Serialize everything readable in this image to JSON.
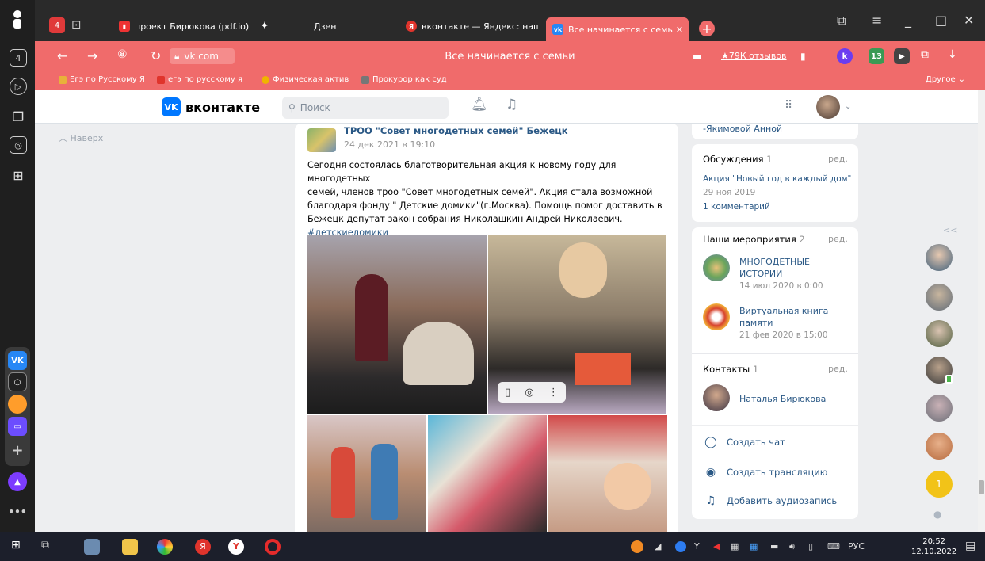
{
  "browser": {
    "tabs": [
      {
        "label": "проект Бирюкова (pdf.io)",
        "favicon": "pdf-icon"
      },
      {
        "label": "Дзен",
        "favicon": "zen-icon"
      },
      {
        "label": "вконтакте — Яндекс: наш",
        "favicon": "yandex-icon"
      },
      {
        "label": "Все начинается с семь",
        "favicon": "vk-icon",
        "active": true
      }
    ],
    "tab_count_badge": "4",
    "url": "vk.com",
    "page_title": "Все начинается с семьи",
    "reviews": "★79К отзывов",
    "ext_badge": "13",
    "other_bookmarks": "Другое",
    "bookmarks": [
      {
        "label": "Егэ по Русскому Я",
        "color": "#e8b13a"
      },
      {
        "label": "егэ по русскому я",
        "color": "#e0342c"
      },
      {
        "label": "Физическая актив",
        "color": "#f0b400"
      },
      {
        "label": "Прокурор как суд",
        "color": "#777777"
      }
    ],
    "accent_color": "#f06b6b"
  },
  "vk": {
    "logo_text": "вконтакте",
    "logo_badge": "VK",
    "search_placeholder": "Поиск",
    "back_to_top": "Наверх",
    "post": {
      "group_name": "ТРОО \"Совет многодетных семей\" Бежецк",
      "date": "24 дек 2021 в 19:10",
      "text_lines": [
        "Сегодня состоялась благотворительная акция к новому году для многодетных",
        "семей, членов троо \"Совет многодетных семей\". Акция стала возможной",
        "благодаря фонду \" Детские домики\"(г.Москва). Помощь помог доставить в",
        "Бежецк депутат закон собрания Николашкин Андрей Николаевич."
      ],
      "hashtag": "#детскиедомики"
    },
    "sidebar": {
      "top_link": "-Якимовой Анной",
      "discussions": {
        "title": "Обсуждения",
        "count": "1",
        "edit": "ред.",
        "topic": "Акция \"Новый год в каждый дом\"",
        "date": "29 ноя 2019",
        "comments": "1 комментарий"
      },
      "events": {
        "title": "Наши мероприятия",
        "count": "2",
        "edit": "ред.",
        "items": [
          {
            "name_line1": "МНОГОДЕТНЫЕ",
            "name_line2": "ИСТОРИИ",
            "date": "14 июл 2020 в 0:00"
          },
          {
            "name_line1": "Виртуальная книга",
            "name_line2": "памяти",
            "date": "21 фев 2020 в 15:00"
          }
        ]
      },
      "contacts": {
        "title": "Контакты",
        "count": "1",
        "edit": "ред.",
        "person": "Наталья Бирюкова"
      },
      "actions": [
        "Создать чат",
        "Создать трансляцию",
        "Добавить аудиозапись"
      ]
    },
    "friends_badge": "1",
    "collapse": "<<"
  },
  "taskbar": {
    "lang": "РУС",
    "time": "20:52",
    "date": "12.10.2022"
  }
}
